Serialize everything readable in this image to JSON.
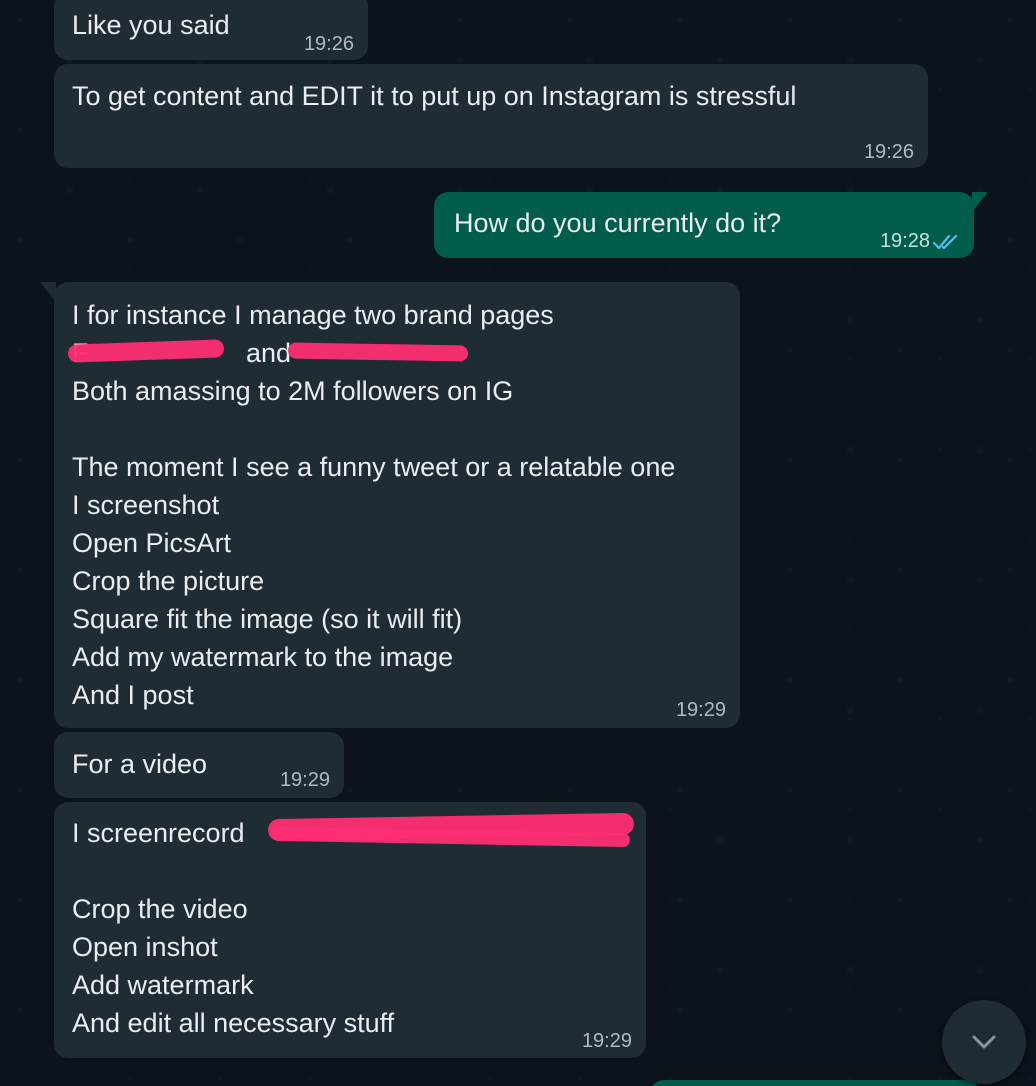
{
  "messages": [
    {
      "direction": "in",
      "lines": [
        "Like you said"
      ],
      "time": "19:26"
    },
    {
      "direction": "in",
      "lines": [
        "To get content and EDIT it to put up on Instagram is stressful"
      ],
      "time": "19:26"
    },
    {
      "direction": "out",
      "lines": [
        "How do you currently do it?"
      ],
      "time": "19:28",
      "status": "read"
    },
    {
      "direction": "in",
      "lines": [
        "I for instance I manage two brand pages",
        "F                     and                         ",
        "Both amassing to 2M followers on IG",
        "",
        "The moment I see a funny tweet or a relatable one",
        "I screenshot",
        "Open PicsArt",
        "Crop the picture",
        "Square fit the image (so it will fit)",
        "Add my watermark to the image",
        "And I post"
      ],
      "time": "19:29"
    },
    {
      "direction": "in",
      "lines": [
        "For a video"
      ],
      "time": "19:29"
    },
    {
      "direction": "in",
      "lines": [
        "I screenrecord",
        "",
        "Crop the video",
        "Open inshot",
        "Add watermark",
        "And edit all necessary stuff"
      ],
      "time": "19:29"
    }
  ],
  "colors": {
    "background": "#0b141a",
    "incoming_bubble": "#202c33",
    "outgoing_bubble": "#005c4b",
    "read_ticks": "#53bdeb",
    "redaction": "#ff2e73"
  },
  "icons": {
    "read_receipt": "double-check-icon",
    "scroll_down": "chevron-down-icon"
  }
}
